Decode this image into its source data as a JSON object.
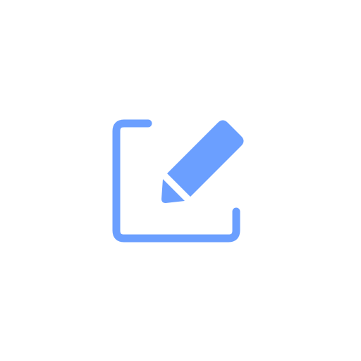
{
  "icon": {
    "name": "edit-icon",
    "accent_color": "#6b9fff",
    "background_color": "#ffffff"
  }
}
